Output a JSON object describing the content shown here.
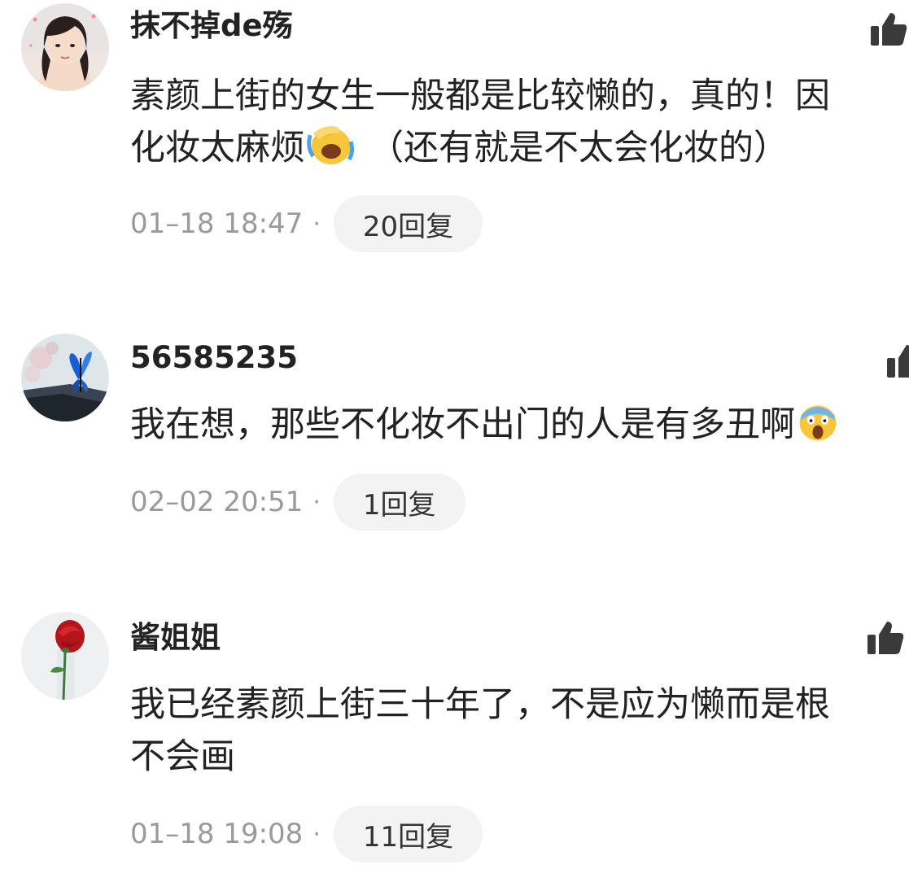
{
  "comments": [
    {
      "username": "抹不掉de殇",
      "lines": [
        {
          "text": "素颜上街的女生一般都是比较懒的，真的！因",
          "emoji": null,
          "after": ""
        },
        {
          "text": "化妆太麻烦",
          "emoji": "face-palm-laughing-emoji",
          "after": "（还有就是不太会化妆的）"
        }
      ],
      "timestamp": "01–18 18:47",
      "separator": "·",
      "reply_label": "20回复",
      "avatar_icon": "girl-avatar"
    },
    {
      "username": "56585235",
      "lines": [
        {
          "text": "我在想，那些不化妆不出门的人是有多丑啊",
          "emoji": "screaming-face-emoji",
          "after": ""
        }
      ],
      "timestamp": "02–02 20:51",
      "separator": "·",
      "reply_label": "1回复",
      "avatar_icon": "butterfly-avatar"
    },
    {
      "username": "酱姐姐",
      "lines": [
        {
          "text": "我已经素颜上街三十年了，不是应为懒而是根",
          "emoji": null,
          "after": ""
        },
        {
          "text": "不会画",
          "emoji": null,
          "after": ""
        }
      ],
      "timestamp": "01–18 19:08",
      "separator": "·",
      "reply_label": "11回复",
      "avatar_icon": "rose-avatar"
    }
  ],
  "colors": {
    "text": "#222222",
    "meta": "#9a9a9a",
    "reply_bg": "#f3f3f3",
    "like_icon": "#3a3a3a"
  },
  "icons": {
    "like": "thumbs-up-icon"
  }
}
